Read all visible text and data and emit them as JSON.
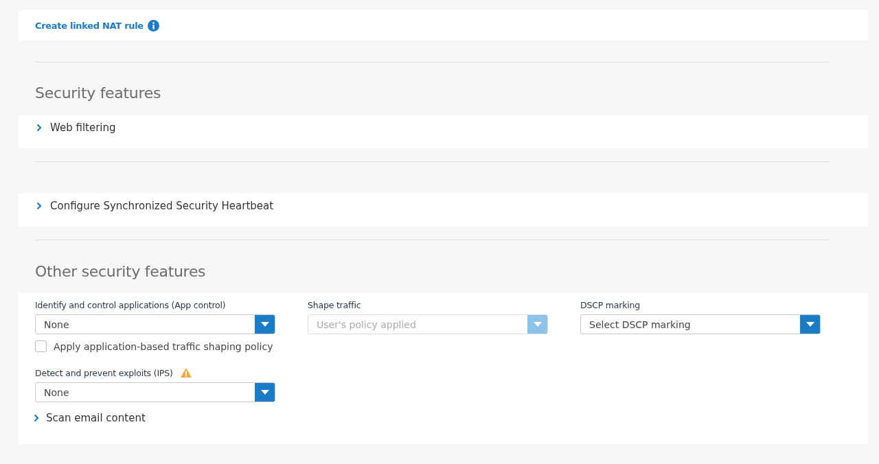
{
  "nat_link": {
    "label": "Create linked NAT rule"
  },
  "security_features": {
    "heading": "Security features",
    "sections": [
      {
        "label": "Web filtering",
        "expanded": false
      }
    ]
  },
  "heartbeat": {
    "label": "Configure Synchronized Security Heartbeat",
    "expanded": false
  },
  "other_security_features": {
    "heading": "Other security features",
    "selects": [
      {
        "label": "Identify and control applications (App control)",
        "value": "None",
        "disabled": false,
        "warning": false
      },
      {
        "label": "Shape traffic",
        "value": "User's policy applied",
        "disabled": true,
        "warning": false
      },
      {
        "label": "DSCP marking",
        "value": "Select DSCP marking",
        "disabled": false,
        "warning": false
      }
    ],
    "checkbox": {
      "label": "Apply application-based traffic shaping policy",
      "checked": false
    },
    "ips": {
      "label": "Detect and prevent exploits (IPS)",
      "value": "None",
      "disabled": false,
      "warning": true
    },
    "scan_email": {
      "label": "Scan email content",
      "expanded": false
    }
  }
}
